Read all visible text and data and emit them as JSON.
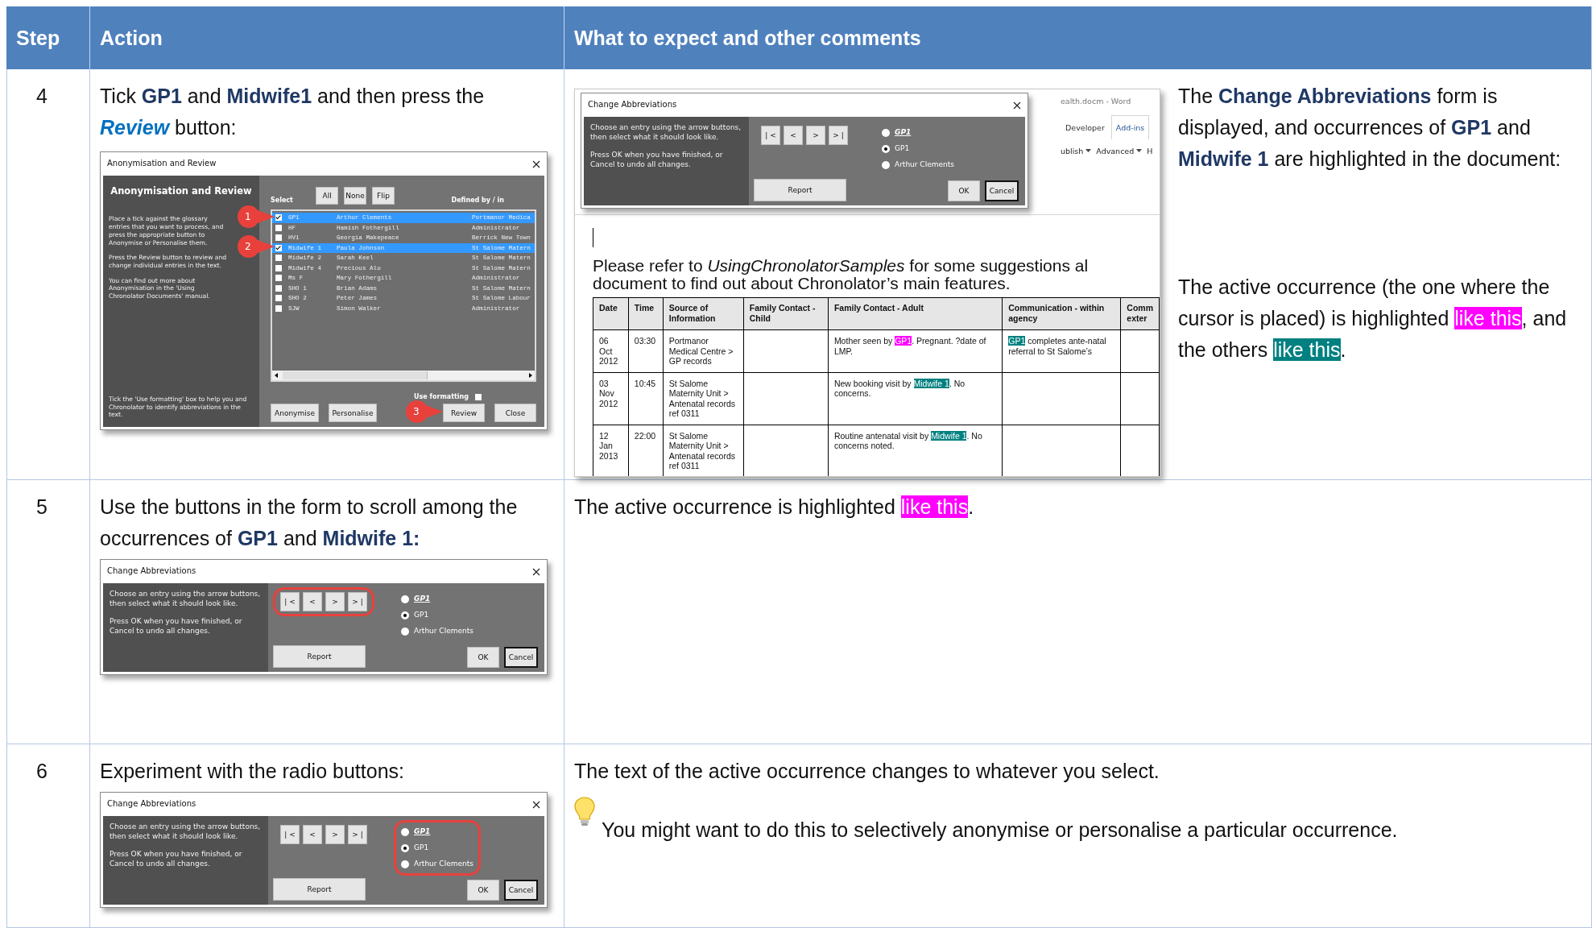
{
  "table": {
    "columns": [
      {
        "label": "Step"
      },
      {
        "label": "Action"
      },
      {
        "label": "What to expect and other comments"
      }
    ],
    "rows": [
      {
        "step": "4",
        "action_text": [
          {
            "text": "Tick ",
            "kind": "plain"
          },
          {
            "text": "GP1",
            "kind": "bold"
          },
          {
            "text": " and ",
            "kind": "plain"
          },
          {
            "text": "Midwife1",
            "kind": "bold"
          },
          {
            "text": " and then press the ",
            "kind": "plain"
          },
          {
            "text": "Review",
            "kind": "emphasis"
          },
          {
            "text": "  button:",
            "kind": "plain"
          }
        ],
        "action_dialog": {
          "kind": "anonymisation",
          "title": "Anonymisation and Review",
          "heading": "Anonymisation and Review",
          "paragraphs": [
            "Place a tick against the glossary entries that you want to process, and press the appropriate button to Anonymise or Personalise them.",
            "Press the Review button to review and change individual entries in the text.",
            "You can find out more about Anonymisation in the 'Using Chronolator Documents' manual."
          ],
          "footnote": "Tick the 'Use formatting' box to help you and Chronolator to identify abbreviations in the text.",
          "select_label": "Select",
          "select_buttons": [
            "All",
            "None",
            "Flip"
          ],
          "defined_label": "Defined by / in",
          "entries": [
            {
              "code": "GP1",
              "name": "Arthur Clements",
              "defined": "Portmanor Medica",
              "checked": true,
              "selected": true
            },
            {
              "code": "HF",
              "name": "Hamish Fothergill",
              "defined": "Administrator",
              "checked": false,
              "selected": false
            },
            {
              "code": "HV1",
              "name": "Georgia Makepeace",
              "defined": "Berrick New Town",
              "checked": false,
              "selected": false
            },
            {
              "code": "Midwife 1",
              "name": "Paula Johnson",
              "defined": "St Salome Matern",
              "checked": true,
              "selected": true
            },
            {
              "code": "Midwife 2",
              "name": "Sarah Keel",
              "defined": "St Salome Matern",
              "checked": false,
              "selected": false
            },
            {
              "code": "Midwife 4",
              "name": "Precious Alu",
              "defined": "St Salome Matern",
              "checked": false,
              "selected": false
            },
            {
              "code": "Ms F",
              "name": "Mary Fothergill",
              "defined": "Administrator",
              "checked": false,
              "selected": false
            },
            {
              "code": "SHO 1",
              "name": "Brian Adams",
              "defined": "St Salome Matern",
              "checked": false,
              "selected": false
            },
            {
              "code": "SHO 2",
              "name": "Peter James",
              "defined": "St Salome Labour",
              "checked": false,
              "selected": false
            },
            {
              "code": "SJW",
              "name": "Simon Walker",
              "defined": "Administrator",
              "checked": false,
              "selected": false
            }
          ],
          "use_formatting": {
            "label": "Use formatting",
            "checked": false
          },
          "buttons": [
            "Anonymise",
            "Personalise",
            "Review",
            "Close"
          ],
          "callouts": [
            "1",
            "2",
            "3"
          ]
        },
        "comments": [
          {
            "kind": "screenshot",
            "window_title": "ealth.docm - Word",
            "tabs": [
              {
                "label": "Developer",
                "selected": false
              },
              {
                "label": "Add-ins",
                "selected": true
              }
            ],
            "ribbon_commands": [
              {
                "label": "ublish",
                "dropdown": true
              },
              {
                "label": "Advanced",
                "dropdown": true
              },
              {
                "label": "H",
                "dropdown": false
              }
            ],
            "dialog": {
              "title": "Change Abbreviations",
              "paragraphs": [
                "Choose an entry using the arrow buttons, then select what it should look like.",
                "Press OK when you have finished, or Cancel to undo all changes."
              ],
              "navigation": {
                "highlighted": false,
                "buttons": [
                  "| <",
                  "<",
                  ">",
                  "> |"
                ]
              },
              "report_button": "Report",
              "option_group": {
                "highlighted": false,
                "options": [
                  {
                    "label": "GP1",
                    "kind": "formatted",
                    "selected": false
                  },
                  {
                    "label": "GP1",
                    "kind": "plain",
                    "selected": true
                  },
                  {
                    "label": "Arthur Clements",
                    "kind": "plain",
                    "selected": false
                  }
                ]
              },
              "ok_button": "OK",
              "cancel_button": "Cancel"
            },
            "intro": [
              {
                "text": "Please refer to ",
                "kind": "plain"
              },
              {
                "text": "UsingChronolatorSamples",
                "kind": "italic"
              },
              {
                "text": " for some suggestions al document to find out about Chronolator’s main features.",
                "kind": "plain"
              }
            ],
            "doc_table": {
              "columns": [
                "Date",
                "Time",
                "Source of Information",
                "Family Contact - Child",
                "Family Contact - Adult",
                "Communication - within agency",
                "Comm\nexter"
              ],
              "rows": [
                {
                  "date": "06 Oct 2012",
                  "time": "03:30",
                  "source": "Portmanor Medical Centre > GP records",
                  "adult": [
                    {
                      "text": "Mother seen by ",
                      "kind": "plain"
                    },
                    {
                      "text": "GP1",
                      "kind": "active"
                    },
                    {
                      "text": ". Pregnant. ?date of LMP.",
                      "kind": "plain"
                    }
                  ],
                  "agency": [
                    {
                      "text": "GP1",
                      "kind": "other"
                    },
                    {
                      "text": " completes ante-natal referral to St Salome’s",
                      "kind": "plain"
                    }
                  ]
                },
                {
                  "date": "03 Nov 2012",
                  "time": "10:45",
                  "source": "St Salome Maternity Unit > Antenatal records ref 0311",
                  "adult": [
                    {
                      "text": "New booking visit by ",
                      "kind": "plain"
                    },
                    {
                      "text": "Midwife 1",
                      "kind": "other"
                    },
                    {
                      "text": ". No concerns.",
                      "kind": "plain"
                    }
                  ]
                },
                {
                  "date": "12 Jan 2013",
                  "time": "22:00",
                  "source": "St Salome Maternity Unit > Antenatal records ref 0311",
                  "adult": [
                    {
                      "text": "Routine antenatal visit by ",
                      "kind": "plain"
                    },
                    {
                      "text": "Midwife 1",
                      "kind": "other"
                    },
                    {
                      "text": ". No concerns noted.",
                      "kind": "plain"
                    }
                  ]
                }
              ]
            }
          },
          {
            "kind": "text",
            "segments": [
              {
                "text": "The ",
                "kind": "plain"
              },
              {
                "text": "Change Abbreviations",
                "kind": "bold"
              },
              {
                "text": " form is displayed, and occurrences of ",
                "kind": "plain"
              },
              {
                "text": "GP1",
                "kind": "bold"
              },
              {
                "text": " and ",
                "kind": "plain"
              },
              {
                "text": "Midwife 1",
                "kind": "bold"
              },
              {
                "text": " are highlighted in the document:",
                "kind": "plain"
              }
            ]
          },
          {
            "kind": "text",
            "segments": [
              {
                "text": "The active occurrence (the one where the cursor is placed) is highlighted  ",
                "kind": "plain"
              },
              {
                "text": "like this",
                "kind": "active"
              },
              {
                "text": ", and the others ",
                "kind": "plain"
              },
              {
                "text": "like this",
                "kind": "other"
              },
              {
                "text": ".",
                "kind": "plain"
              }
            ]
          }
        ]
      },
      {
        "step": "5",
        "action_text": [
          {
            "text": "Use the buttons in the form to scroll among the occurrences of ",
            "kind": "plain"
          },
          {
            "text": "GP1",
            "kind": "bold"
          },
          {
            "text": " and ",
            "kind": "plain"
          },
          {
            "text": "Midwife 1:",
            "kind": "bold"
          }
        ],
        "action_dialog": {
          "kind": "change",
          "title": "Change Abbreviations",
          "paragraphs": [
            "Choose an entry using the arrow buttons, then select what it should look like.",
            "Press OK when you have finished, or Cancel to undo all changes."
          ],
          "navigation": {
            "highlighted": true,
            "buttons": [
              "| <",
              "<",
              ">",
              "> |"
            ]
          },
          "report_button": "Report",
          "option_group": {
            "highlighted": false,
            "options": [
              {
                "label": "GP1",
                "kind": "formatted",
                "selected": false
              },
              {
                "label": "GP1",
                "kind": "plain",
                "selected": true
              },
              {
                "label": "Arthur Clements",
                "kind": "plain",
                "selected": false
              }
            ]
          },
          "ok_button": "OK",
          "cancel_button": "Cancel"
        },
        "comments": [
          {
            "kind": "text",
            "segments": [
              {
                "text": "The active occurrence is highlighted  ",
                "kind": "plain"
              },
              {
                "text": "like this",
                "kind": "active"
              },
              {
                "text": ".",
                "kind": "plain"
              }
            ]
          }
        ]
      },
      {
        "step": "6",
        "action_text": [
          {
            "text": "Experiment with the radio buttons:",
            "kind": "plain"
          }
        ],
        "action_dialog": {
          "kind": "change",
          "title": "Change Abbreviations",
          "paragraphs": [
            "Choose an entry using the arrow buttons, then select what it should look like.",
            "Press OK when you have finished, or Cancel to undo all changes."
          ],
          "navigation": {
            "highlighted": false,
            "buttons": [
              "| <",
              "<",
              ">",
              "> |"
            ]
          },
          "report_button": "Report",
          "option_group": {
            "highlighted": true,
            "options": [
              {
                "label": "GP1",
                "kind": "formatted",
                "selected": false
              },
              {
                "label": "GP1",
                "kind": "plain",
                "selected": true
              },
              {
                "label": "Arthur Clements",
                "kind": "plain",
                "selected": false
              }
            ]
          },
          "ok_button": "OK",
          "cancel_button": "Cancel"
        },
        "comments": [
          {
            "kind": "text",
            "segments": [
              {
                "text": "The text of the active occurrence changes to whatever you select.",
                "kind": "plain"
              }
            ]
          },
          {
            "kind": "tip",
            "text": "You might want to do this to selectively anonymise or personalise a particular occurrence."
          }
        ]
      }
    ]
  }
}
